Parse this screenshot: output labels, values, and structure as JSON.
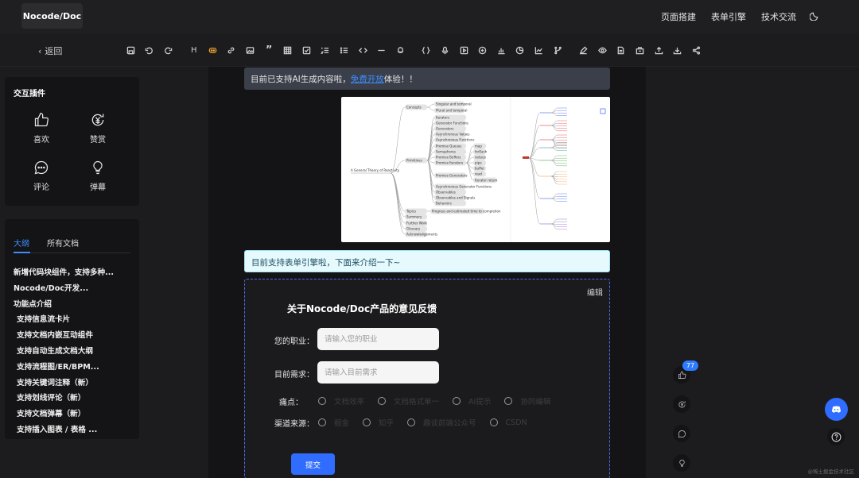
{
  "nav": {
    "logo": "Nocode/Doc",
    "links": [
      "页面搭建",
      "表单引擎",
      "技术交流"
    ],
    "theme_icon": "moon-icon"
  },
  "toolbar": {
    "back_label": "返回",
    "tools": [
      "save-icon",
      "undo-icon",
      "redo-icon",
      "heading-icon",
      "discord-icon",
      "link-icon",
      "image-icon",
      "quote-icon",
      "table-icon",
      "checkbox-icon",
      "ordered-list-icon",
      "bullet-list-icon",
      "code-icon",
      "hr-icon",
      "tips-icon",
      "code-block-icon",
      "audio-icon",
      "video-icon",
      "embed-icon",
      "bar-chart-icon",
      "pie-chart-icon",
      "line-chart-icon",
      "flow-icon",
      "draw-icon",
      "preview-icon",
      "export-icon",
      "archive-icon",
      "upload-icon",
      "download-icon",
      "share-icon"
    ],
    "heading_label": "H",
    "quote_label": "”"
  },
  "plugins": {
    "title": "交互插件",
    "items": [
      {
        "label": "喜欢",
        "icon": "thumbs-up-icon"
      },
      {
        "label": "赞赏",
        "icon": "reward-icon"
      },
      {
        "label": "评论",
        "icon": "comment-icon"
      },
      {
        "label": "弹幕",
        "icon": "bulb-icon"
      }
    ]
  },
  "outline": {
    "tabs": [
      "大纲",
      "所有文档"
    ],
    "items": [
      {
        "label": "新增代码块组件，支持多种...",
        "sub": false
      },
      {
        "label": "Nocode/Doc开发...",
        "sub": false
      },
      {
        "label": "功能点介绍",
        "sub": false
      },
      {
        "label": "支持信息流卡片",
        "sub": true
      },
      {
        "label": "支持文档内嵌互动组件",
        "sub": true
      },
      {
        "label": "支持自动生成文档大纲",
        "sub": true
      },
      {
        "label": "支持流程图/ER/BPM...",
        "sub": true
      },
      {
        "label": "支持关键词注释（新）",
        "sub": true
      },
      {
        "label": "支持划线评论（新）",
        "sub": true
      },
      {
        "label": "支持文档弹幕（新）",
        "sub": true
      },
      {
        "label": "支持插入图表 / 表格 ...",
        "sub": true
      }
    ]
  },
  "content": {
    "banner1_prefix": "目前已支持AI生成内容啦，",
    "banner1_link": "免费开放",
    "banner1_suffix": "体验！！",
    "banner2": "目前支持表单引擎啦，下面来介绍一下~",
    "mindmap": {
      "root": "A General Theory of Reactivity",
      "branches": [
        "Concepts",
        "Primitives",
        "Topics",
        "Summary",
        "Further Work",
        "Glossary",
        "Acknowledgements"
      ],
      "concept_nodes": [
        "Singular and temporal",
        "Plural and temporal"
      ],
      "primitive_nodes": [
        "Iterators",
        "Generator Functions",
        "Generators",
        "Asynchronous Values",
        "Asynchronous Functions",
        "Promise Queues",
        "Semaphores",
        "Promise Buffers",
        "Promise Iterators",
        "Promise Generators",
        "Asynchronous Generator Functions",
        "Observables",
        "Observables and Signals",
        "Behaviors"
      ],
      "iterator_nodes": [
        "map",
        "forEach",
        "reduce",
        "pipe",
        "buffer",
        "read",
        "Iterator return"
      ],
      "topic_node": "Progress and estimated time to completion"
    }
  },
  "form": {
    "edit_label": "编辑",
    "title": "关于Nocode/Doc产品的意见反馈",
    "job_label": "您的职业：",
    "job_placeholder": "请输入您的职业",
    "need_label": "目前需求：",
    "need_placeholder": "请输入目前需求",
    "pain_label": "痛点：",
    "pain_options": [
      "文档效率",
      "文档格式单一",
      "AI提示",
      "协同编辑"
    ],
    "channel_label": "渠道来源：",
    "channel_options": [
      "掘金",
      "知乎",
      "趣谈前端公众号",
      "CSDN"
    ],
    "submit_label": "提交"
  },
  "float": {
    "like_count": "77",
    "icons": [
      "thumbs-up-icon",
      "reward-icon",
      "comment-icon",
      "bulb-icon"
    ]
  },
  "watermark": "@稀土掘金技术社区"
}
